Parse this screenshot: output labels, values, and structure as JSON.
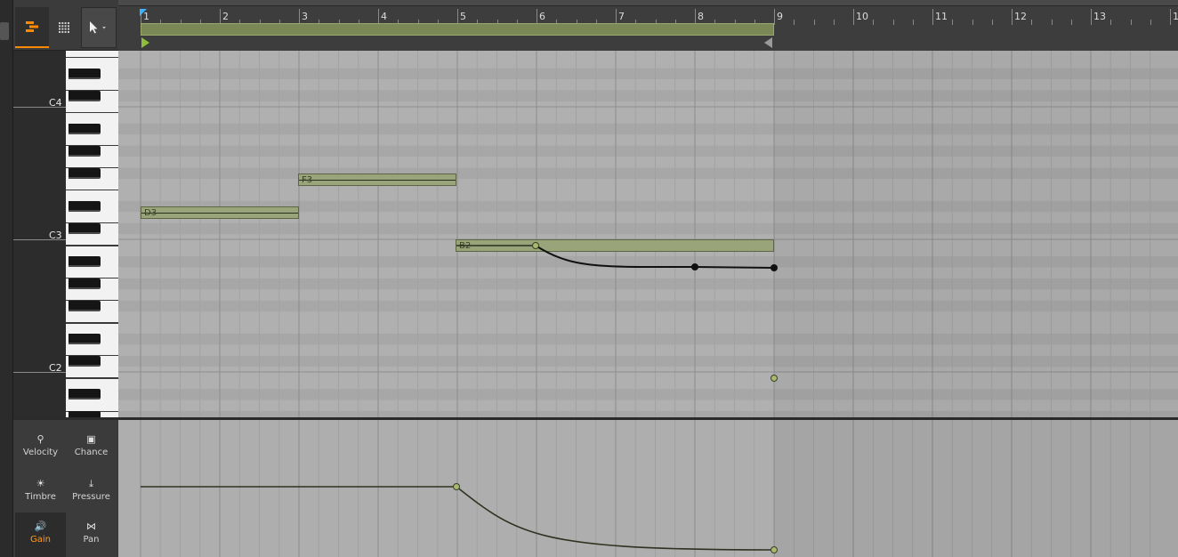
{
  "ruler": {
    "bars": [
      "1",
      "2",
      "3",
      "4",
      "5",
      "6",
      "7",
      "8",
      "9",
      "10",
      "11",
      "12",
      "13",
      "1"
    ]
  },
  "keyboard": {
    "labels": [
      "C4",
      "C3",
      "C2"
    ]
  },
  "notes": [
    {
      "label": "D3"
    },
    {
      "label": "F3"
    },
    {
      "label": "B2"
    }
  ],
  "expression": {
    "velocity": "Velocity",
    "chance": "Chance",
    "timbre": "Timbre",
    "pressure": "Pressure",
    "gain": "Gain",
    "pan": "Pan"
  },
  "colors": {
    "accent": "#ff8a00",
    "note_fill": "#9aa47a",
    "loop": "#7a8856",
    "playhead": "#3bb3ff"
  }
}
